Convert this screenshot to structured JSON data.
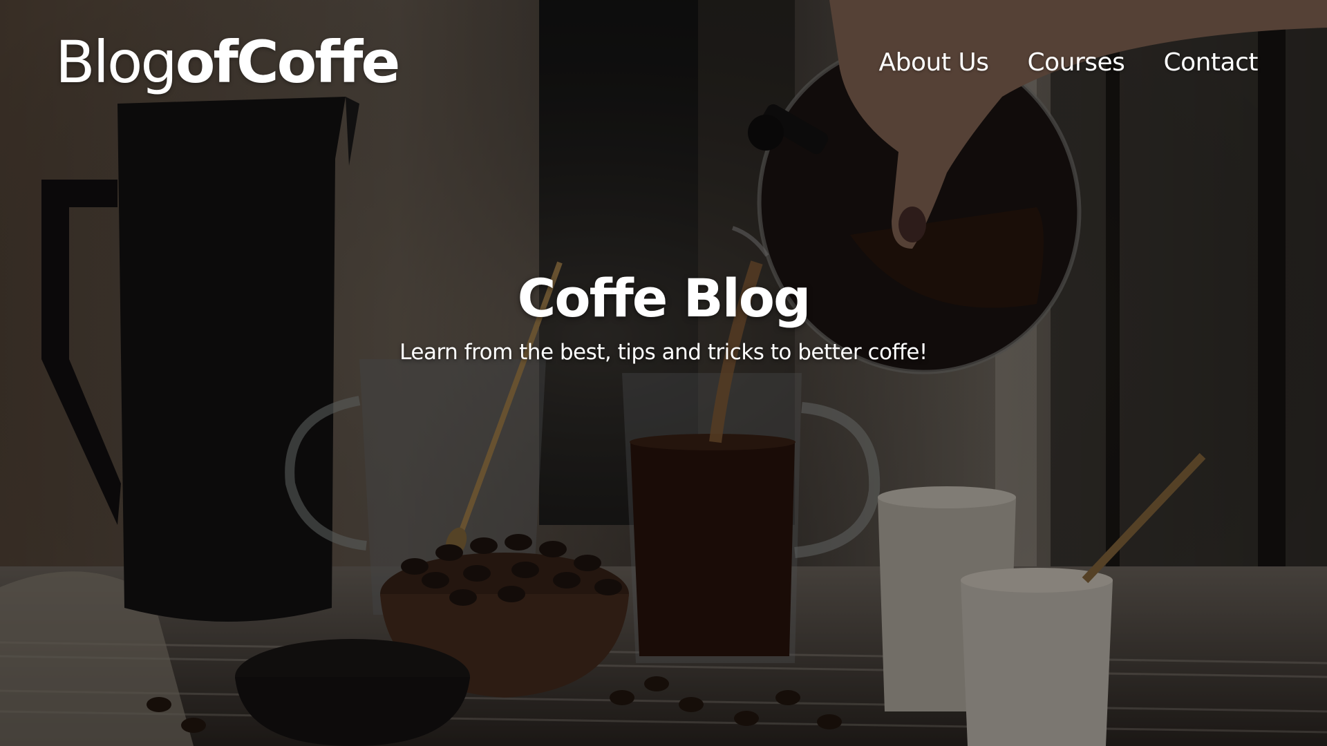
{
  "brand": {
    "name_light": "Blog",
    "name_bold": "ofCoffe"
  },
  "nav": {
    "items": [
      {
        "label": "About Us"
      },
      {
        "label": "Courses"
      },
      {
        "label": "Contact"
      }
    ]
  },
  "hero": {
    "title": "Coffe Blog",
    "subtitle": "Learn from the best, tips and tricks to better coffe!",
    "background": "coffee-pouring-photo"
  },
  "colors": {
    "text": "#ffffff",
    "background_dark": "#141210",
    "coffee": "#2a140c",
    "cream": "#d8d0c4"
  }
}
